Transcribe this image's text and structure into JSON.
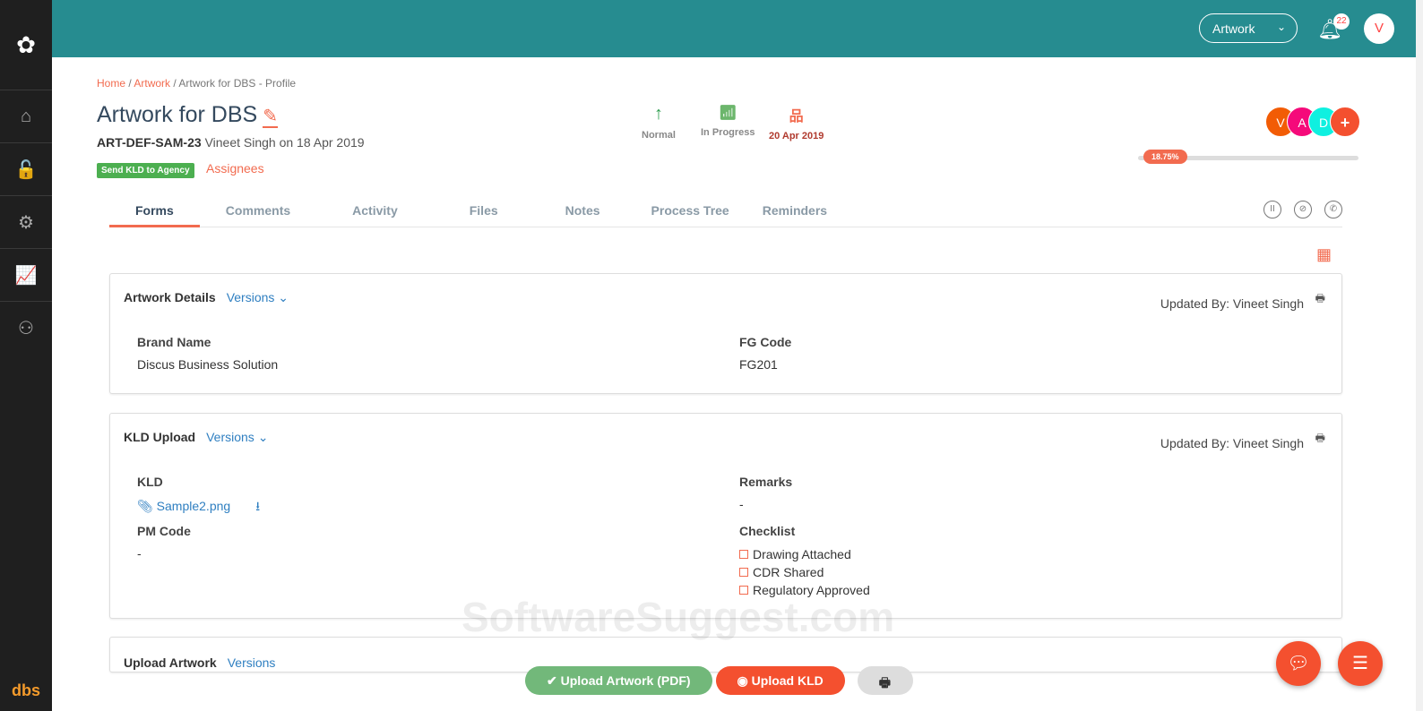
{
  "sidebar": {
    "logo": "✿",
    "items": [
      "⌂",
      "🔓",
      "⚙",
      "📈",
      "⚇"
    ],
    "bottom_logo": "dbs"
  },
  "topbar": {
    "module": "Artwork",
    "notifications": "22",
    "user_initial": "V"
  },
  "breadcrumb": [
    "Home",
    "Artwork",
    "Artwork for DBS - Profile"
  ],
  "title": "Artwork for DBS",
  "code": "ART-DEF-SAM-23",
  "creator": "Vineet Singh on 18 Apr 2019",
  "status_tag": "Send KLD to Agency",
  "assignees_label": "Assignees",
  "stats": {
    "priority": "Normal",
    "status": "In Progress",
    "due": "20 Apr 2019"
  },
  "people": [
    "V",
    "A",
    "D",
    "+"
  ],
  "colors": {
    "teal": "#268c90",
    "accent": "#f26b4f"
  },
  "progress": {
    "label": "18.75%",
    "value": 18.75
  },
  "tabs": [
    "Forms",
    "Comments",
    "Activity",
    "Files",
    "Notes",
    "Process Tree",
    "Reminders"
  ],
  "cards": {
    "artwork": {
      "title": "Artwork Details",
      "versions": "Versions ⌄",
      "updated": "Updated By: Vineet Singh",
      "brand_label": "Brand Name",
      "brand": "Discus Business Solution",
      "fg_label": "FG Code",
      "fg": "FG201"
    },
    "kld": {
      "title": "KLD Upload",
      "versions": "Versions ⌄",
      "updated": "Updated By: Vineet Singh",
      "kld_label": "KLD",
      "file": "Sample2.png",
      "pm_label": "PM Code",
      "pm": "-",
      "remarks_label": "Remarks",
      "remarks": "-",
      "checklist_label": "Checklist",
      "checklist": [
        "Drawing Attached",
        "CDR Shared",
        "Regulatory Approved"
      ]
    },
    "upload": {
      "title": "Upload Artwork",
      "versions": "Versions"
    }
  },
  "watermark": "SoftwareSuggest.com",
  "buttons": {
    "upload_artwork": "Upload Artwork (PDF)",
    "upload_kld": "Upload KLD"
  }
}
